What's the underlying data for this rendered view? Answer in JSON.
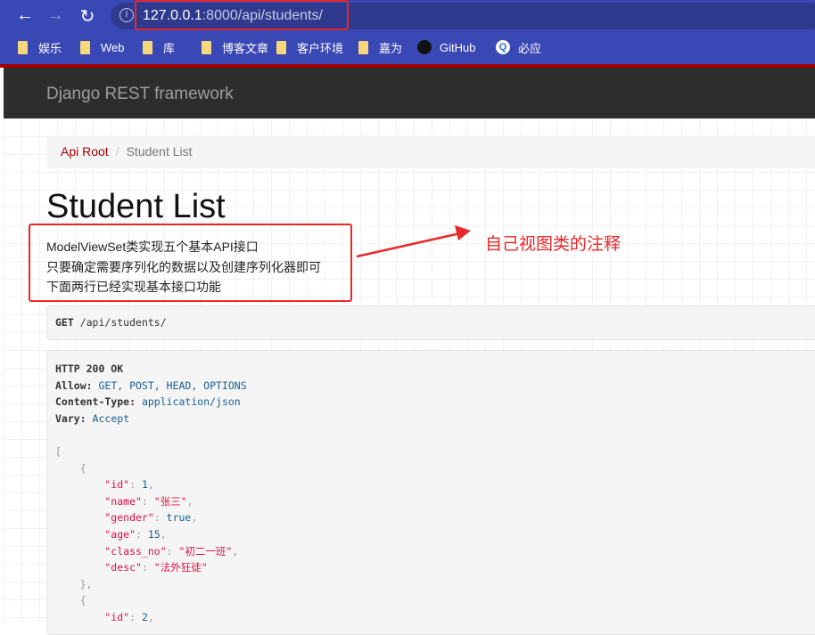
{
  "browser": {
    "url_host": "127.0.0.1",
    "url_rest": ":8000/api/students/",
    "bookmarks": [
      {
        "label": "娱乐",
        "icon": "folder-icon"
      },
      {
        "label": "Web",
        "icon": "folder-icon"
      },
      {
        "label": "库",
        "icon": "folder-icon"
      },
      {
        "label": "博客文章",
        "icon": "folder-icon"
      },
      {
        "label": "客户环境",
        "icon": "folder-icon"
      },
      {
        "label": "嘉为",
        "icon": "folder-icon"
      },
      {
        "label": "GitHub",
        "icon": "github-icon"
      },
      {
        "label": "必应",
        "icon": "bing-icon"
      }
    ]
  },
  "navbar": {
    "brand": "Django REST framework"
  },
  "breadcrumb": {
    "root": "Api Root",
    "separator": "/",
    "current": "Student List"
  },
  "page": {
    "title": "Student List",
    "description": [
      "ModelViewSet类实现五个基本API接口",
      "只要确定需要序列化的数据以及创建序列化器即可",
      "下面两行已经实现基本接口功能"
    ],
    "annotation": "自己视图类的注释"
  },
  "request": {
    "method": "GET",
    "path": " /api/students/"
  },
  "response": {
    "status": "HTTP 200 OK",
    "headers": [
      {
        "k": "Allow:",
        "v": " GET, POST, HEAD, OPTIONS"
      },
      {
        "k": "Content-Type:",
        "v": " application/json"
      },
      {
        "k": "Vary:",
        "v": " Accept"
      }
    ],
    "items": [
      {
        "id": "1",
        "name": "\"张三\"",
        "gender": "true",
        "age": "15",
        "class_no": "\"初二一班\"",
        "desc": "\"法外狂徒\""
      }
    ],
    "next_id": "2"
  },
  "colors": {
    "chrome": "#3a48b5",
    "accent": "#a30000",
    "annotation": "#e8282a"
  }
}
